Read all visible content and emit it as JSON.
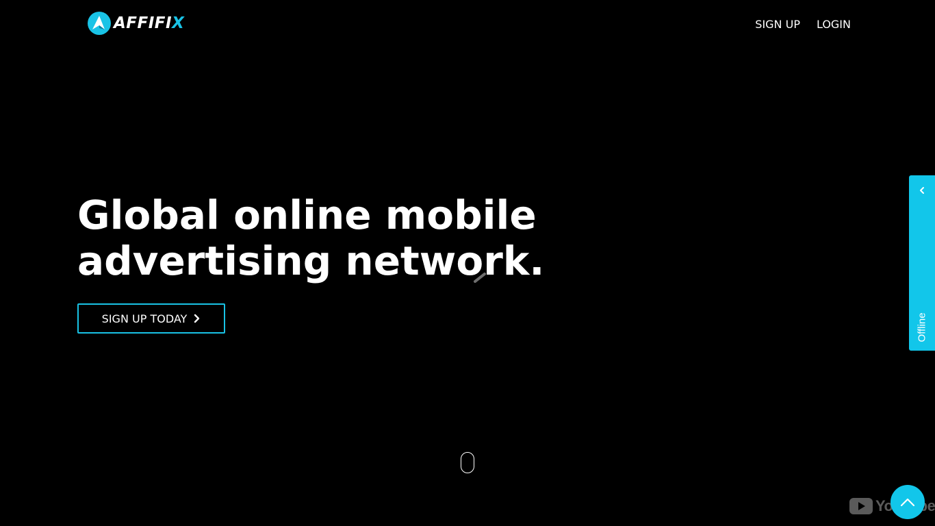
{
  "header": {
    "logo": {
      "text_main": "AFFIFI",
      "text_accent": "X",
      "icon": "affifix-logo-icon"
    },
    "nav": {
      "signup_label": "SIGN UP",
      "login_label": "LOGIN"
    }
  },
  "hero": {
    "title_line1": "Global online mobile",
    "title_line2": "advertising network.",
    "cta_label": "SIGN UP TODAY",
    "cta_icon": "chevron-right-icon"
  },
  "side_tab": {
    "label": "Offline",
    "icon": "chevron-left-icon"
  },
  "watermark": {
    "text": "YouTube",
    "icon": "youtube-play-icon"
  },
  "back_to_top": {
    "icon": "chevron-up-icon"
  },
  "colors": {
    "background": "#000000",
    "accent": "#12c6ea",
    "text": "#ffffff"
  }
}
